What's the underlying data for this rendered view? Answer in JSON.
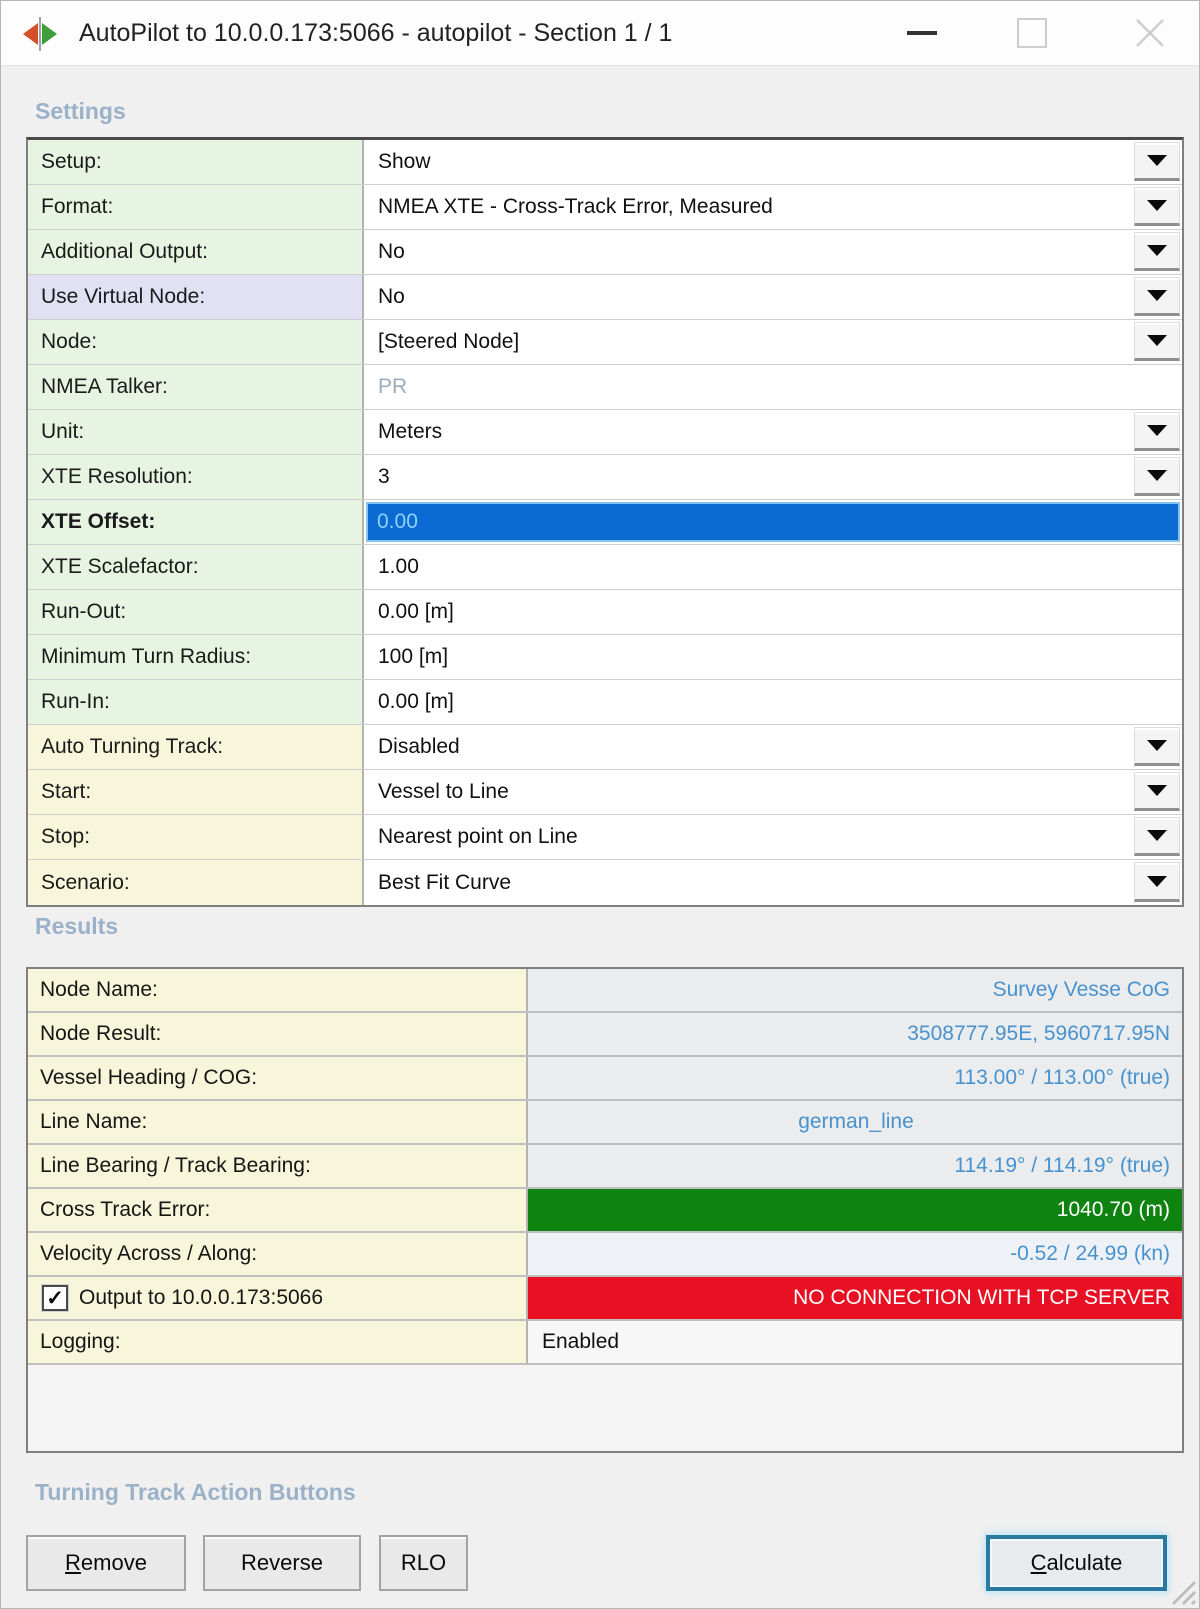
{
  "window": {
    "title": "AutoPilot to 10.0.0.173:5066 - autopilot - Section 1 / 1"
  },
  "icons": {
    "app_icon": "qps-diamond-logo",
    "minimize": "minimize-dash",
    "maximize": "maximize-square",
    "close": "close-x",
    "combo": "dropdown-triangle",
    "checkbox_check": "✓",
    "resize": "diagonal-grip"
  },
  "colors": {
    "header_blue": "#9bb1c7",
    "label_green": "#e8f4e2",
    "label_lavender": "#e2e1f3",
    "label_yellow": "#f8f6da",
    "selection_blue": "#0b6bd3",
    "value_blue": "#4792cf",
    "green_bar": "#0f830f",
    "red_bar": "#e81123",
    "calculate_focus_border": "#2a7aa0"
  },
  "sections": {
    "settings": {
      "label": "Settings",
      "rows": [
        {
          "label": "Setup:",
          "value": "Show",
          "type": "dropdown",
          "label_bg": "green"
        },
        {
          "label": "Format:",
          "value": "NMEA XTE - Cross-Track Error, Measured",
          "type": "dropdown",
          "label_bg": "green"
        },
        {
          "label": "Additional Output:",
          "value": "No",
          "type": "dropdown",
          "label_bg": "green"
        },
        {
          "label": "Use Virtual Node:",
          "value": "No",
          "type": "dropdown",
          "label_bg": "lavender"
        },
        {
          "label": "Node:",
          "value": "[Steered Node]",
          "type": "dropdown",
          "label_bg": "green"
        },
        {
          "label": "NMEA Talker:",
          "value": "PR",
          "type": "readonly",
          "label_bg": "green"
        },
        {
          "label": "Unit:",
          "value": "Meters",
          "type": "dropdown",
          "label_bg": "green"
        },
        {
          "label": "XTE Resolution:",
          "value": "3",
          "type": "dropdown",
          "label_bg": "green"
        },
        {
          "label": "XTE Offset:",
          "value": "0.00",
          "type": "edit-selected",
          "label_bg": "green",
          "bold": true
        },
        {
          "label": "XTE Scalefactor:",
          "value": "1.00",
          "type": "edit",
          "label_bg": "green"
        },
        {
          "label": "Run-Out:",
          "value": "0.00 [m]",
          "type": "edit",
          "label_bg": "green"
        },
        {
          "label": "Minimum Turn Radius:",
          "value": "100 [m]",
          "type": "edit",
          "label_bg": "green"
        },
        {
          "label": "Run-In:",
          "value": "0.00 [m]",
          "type": "edit",
          "label_bg": "green"
        },
        {
          "label": "Auto Turning Track:",
          "value": "Disabled",
          "type": "dropdown",
          "label_bg": "yellow"
        },
        {
          "label": "Start:",
          "value": "Vessel to Line",
          "type": "dropdown",
          "label_bg": "yellow"
        },
        {
          "label": "Stop:",
          "value": "Nearest point on Line",
          "type": "dropdown",
          "label_bg": "yellow"
        },
        {
          "label": "Scenario:",
          "value": "Best Fit Curve",
          "type": "dropdown",
          "label_bg": "yellow"
        }
      ]
    },
    "results": {
      "label": "Results",
      "rows": [
        {
          "label": "Node Name:",
          "value": "Survey Vesse CoG",
          "style": "blue-right"
        },
        {
          "label": "Node Result:",
          "value": "3508777.95E, 5960717.95N",
          "style": "blue-right"
        },
        {
          "label": "Vessel Heading / COG:",
          "value": "113.00° / 113.00° (true)",
          "style": "blue-right"
        },
        {
          "label": "Line Name:",
          "value": "german_line",
          "style": "blue-center"
        },
        {
          "label": "Line Bearing / Track Bearing:",
          "value": "114.19° / 114.19° (true)",
          "style": "blue-right"
        },
        {
          "label": "Cross Track Error:",
          "value": "1040.70 (m)",
          "style": "green-bar"
        },
        {
          "label": "Velocity Across / Along:",
          "value": "-0.52 / 24.99 (kn)",
          "style": "blue-right-tint"
        },
        {
          "label": "Output to 10.0.0.173:5066",
          "value": "NO CONNECTION WITH TCP SERVER",
          "style": "red-bar",
          "checkbox": true,
          "checked": true
        },
        {
          "label": "Logging:",
          "value": "Enabled",
          "style": "plain-left"
        }
      ]
    },
    "actions": {
      "label": "Turning Track Action Buttons",
      "buttons": [
        {
          "id": "remove",
          "label_u": "R",
          "label_rest": "emove",
          "default": false
        },
        {
          "id": "reverse",
          "label_u": "",
          "label_rest": "Reverse",
          "default": false
        },
        {
          "id": "rlo",
          "label_u": "",
          "label_rest": "RLO",
          "default": false
        },
        {
          "id": "calculate",
          "label_u": "C",
          "label_rest": "alculate",
          "default": true
        }
      ]
    }
  }
}
